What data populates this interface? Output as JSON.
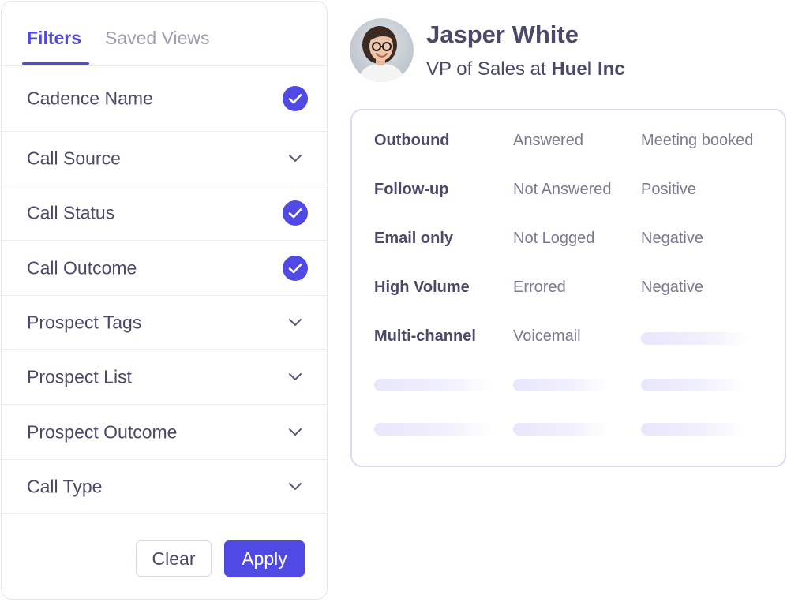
{
  "tabs": [
    {
      "label": "Filters",
      "active": true
    },
    {
      "label": "Saved Views",
      "active": false
    }
  ],
  "filters": [
    {
      "label": "Cadence Name",
      "state": "checked"
    },
    {
      "label": "Call Source",
      "state": "collapsed"
    },
    {
      "label": "Call Status",
      "state": "checked"
    },
    {
      "label": "Call Outcome",
      "state": "checked"
    },
    {
      "label": "Prospect Tags",
      "state": "collapsed"
    },
    {
      "label": "Prospect List",
      "state": "collapsed"
    },
    {
      "label": "Prospect Outcome",
      "state": "collapsed"
    },
    {
      "label": "Call Type",
      "state": "collapsed"
    }
  ],
  "actions": {
    "clear_label": "Clear",
    "apply_label": "Apply"
  },
  "profile": {
    "name": "Jasper White",
    "role_prefix": "VP of Sales at ",
    "company": "Huel Inc"
  },
  "table": {
    "rows": [
      {
        "type": "Outbound",
        "status": "Answered",
        "outcome": "Meeting booked"
      },
      {
        "type": "Follow-up",
        "status": "Not Answered",
        "outcome": "Positive"
      },
      {
        "type": "Email only",
        "status": "Not Logged",
        "outcome": "Negative"
      },
      {
        "type": "High Volume",
        "status": "Errored",
        "outcome": "Negative"
      },
      {
        "type": "Multi-channel",
        "status": "Voicemail",
        "outcome": ""
      }
    ]
  },
  "colors": {
    "accent": "#5149e4",
    "text": "#4a4a68",
    "muted": "#9d9db2",
    "border": "#ececf3",
    "skeleton": "#e8e6fb"
  },
  "icons": {
    "checked": "check-circle-icon",
    "collapsed": "chevron-down-icon"
  }
}
